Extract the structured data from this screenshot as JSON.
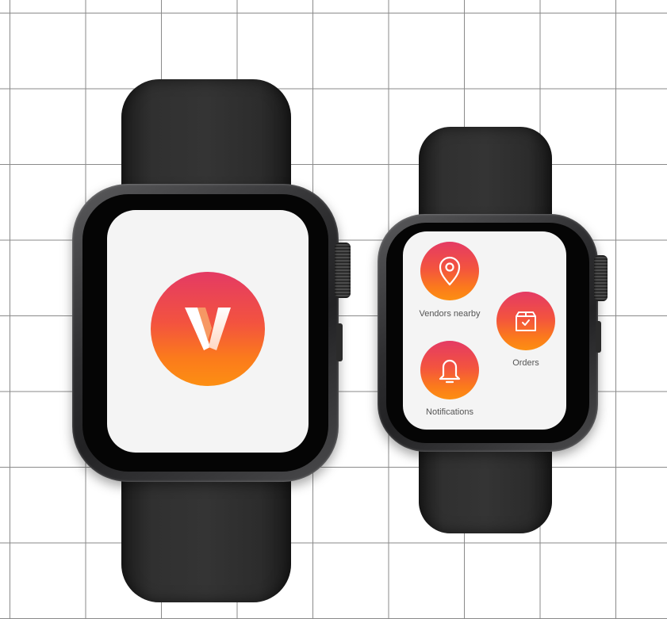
{
  "colors": {
    "gradient_top": "#e43a64",
    "gradient_bottom": "#fd8f12",
    "screen_background": "#f4f4f4",
    "watch_body": "#2e2e30",
    "label_text": "#555555"
  },
  "left_watch": {
    "screen": "splash",
    "logo_letter": "V",
    "logo_icon": "v-logo-icon"
  },
  "right_watch": {
    "screen": "menu",
    "items": [
      {
        "label": "Vendors nearby",
        "icon": "location-pin-icon"
      },
      {
        "label": "Orders",
        "icon": "package-check-icon"
      },
      {
        "label": "Notifications",
        "icon": "bell-icon"
      }
    ]
  }
}
